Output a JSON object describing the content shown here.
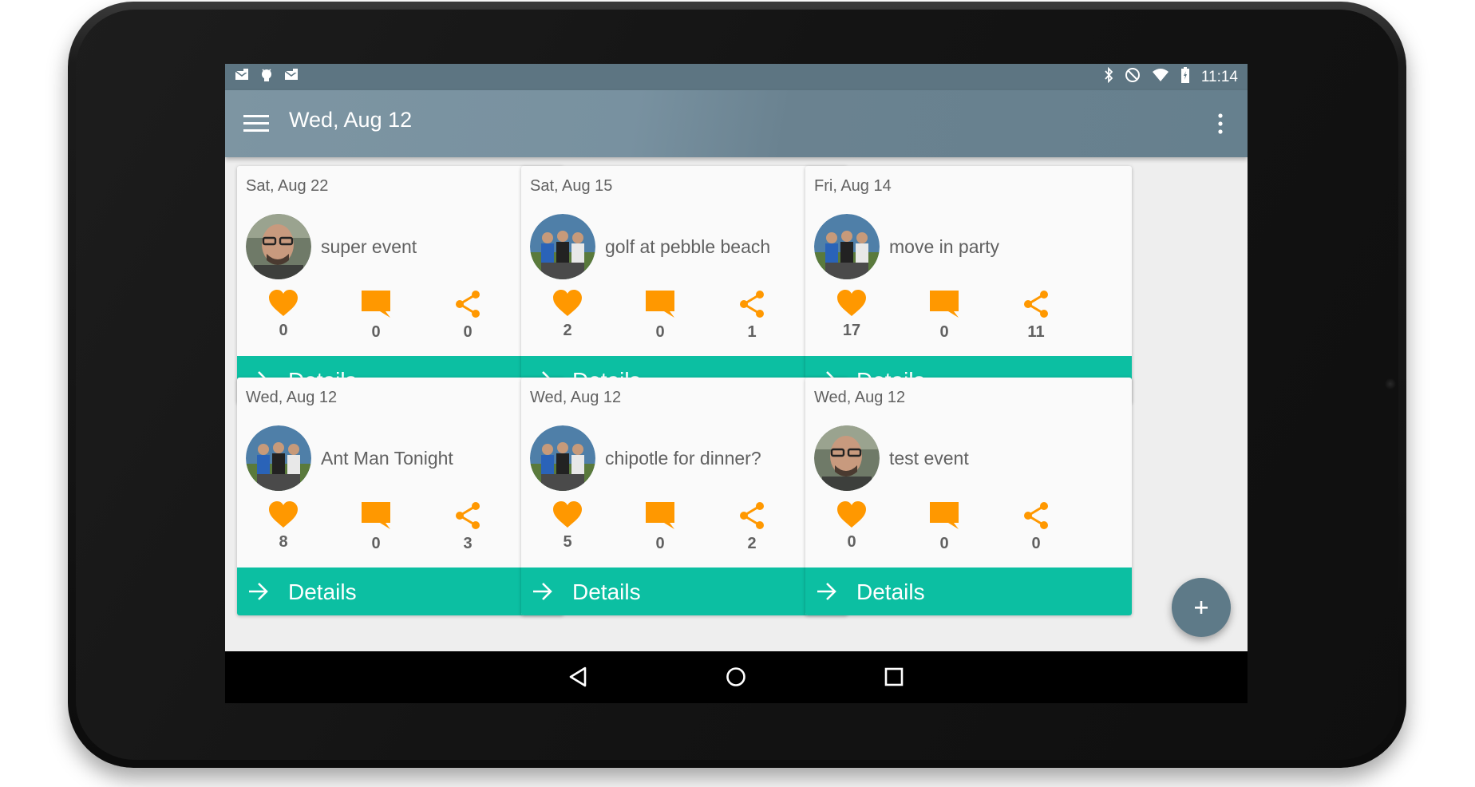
{
  "status_bar": {
    "left_icons": [
      "gmail-icon",
      "android-debug-icon",
      "gmail-icon"
    ],
    "right_icons": [
      "bluetooth-icon",
      "do-not-disturb-icon",
      "wifi-icon",
      "battery-icon"
    ],
    "time": "11:14"
  },
  "toolbar": {
    "title": "Wed, Aug 12",
    "menu_icon": "hamburger-menu-icon",
    "overflow_icon": "more-vert-icon",
    "color": "#7891a0"
  },
  "cards": [
    {
      "date": "Sat, Aug 22",
      "title": "super event",
      "avatar": "portrait-man-glasses",
      "likes": "0",
      "comments": "0",
      "shares": "0",
      "details_label": "Details"
    },
    {
      "date": "Sat, Aug 15",
      "title": "golf at pebble beach",
      "avatar": "group-photo-three-men",
      "likes": "2",
      "comments": "0",
      "shares": "1",
      "details_label": "Details"
    },
    {
      "date": "Fri, Aug 14",
      "title": "move in party",
      "avatar": "group-photo-three-men",
      "likes": "17",
      "comments": "0",
      "shares": "11",
      "details_label": "Details"
    },
    {
      "date": "Wed, Aug 12",
      "title": "Ant Man Tonight",
      "avatar": "group-photo-three-men",
      "likes": "8",
      "comments": "0",
      "shares": "3",
      "details_label": "Details"
    },
    {
      "date": "Wed, Aug 12",
      "title": "chipotle for dinner?",
      "avatar": "group-photo-three-men",
      "likes": "5",
      "comments": "0",
      "shares": "2",
      "details_label": "Details"
    },
    {
      "date": "Wed, Aug 12",
      "title": "test event",
      "avatar": "portrait-man-glasses",
      "likes": "0",
      "comments": "0",
      "shares": "0",
      "details_label": "Details"
    }
  ],
  "fab": {
    "icon": "add-icon"
  },
  "nav_bar": {
    "icons": [
      "back-icon",
      "home-icon",
      "recents-icon"
    ]
  },
  "colors": {
    "accent": "#ff9800",
    "details_bar": "#0cbfa2",
    "fab": "#5e7a88",
    "status_bar": "#5d7582"
  }
}
